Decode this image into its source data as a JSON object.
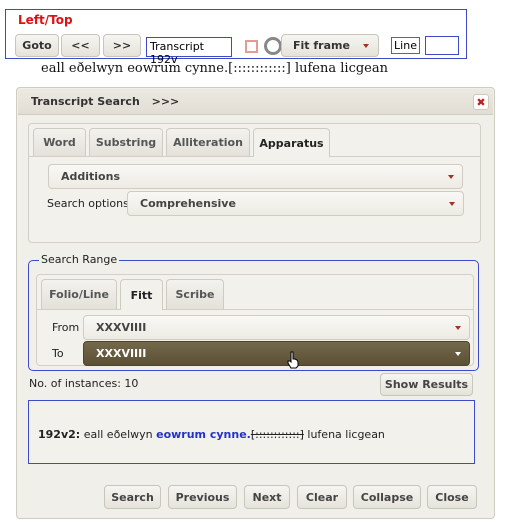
{
  "toolbar": {
    "title": "Left/Top",
    "goto_label": "Goto",
    "prev_label": "<<",
    "next_label": ">>",
    "page_value": "Transcript 192v",
    "fit_label": "Fit frame",
    "line_label": "Line",
    "line_value": ""
  },
  "transcript": {
    "text": "eall eðelwyn eowrum cynne.[::::::::::::] lufena licgean"
  },
  "dialog": {
    "title": "Transcript Search",
    "title_arrows": ">>>",
    "close_symbol": "✖",
    "tabs": [
      "Word",
      "Substring",
      "Alliteration",
      "Apparatus"
    ],
    "active_tab": "Apparatus",
    "apparatus_select": "Additions",
    "search_options_label": "Search options:",
    "search_options_value": "Comprehensive",
    "range": {
      "legend": "Search Range",
      "tabs": [
        "Folio/Line",
        "Fitt",
        "Scribe"
      ],
      "active_tab": "Fitt",
      "from_label": "From",
      "from_value": "XXXVIIII",
      "to_label": "To",
      "to_value": "XXXVIIII"
    },
    "instances_text": "No. of instances: 10",
    "show_results_label": "Show Results",
    "result": {
      "ref": "192v2:",
      "before": "eall eðelwyn",
      "hit": "eowrum cynne.",
      "bracket": "[::::::::::::]",
      "after": "lufena licgean"
    },
    "buttons": [
      "Search",
      "Previous",
      "Next",
      "Clear",
      "Collapse",
      "Close"
    ]
  },
  "colors": {
    "accent_border": "#3d4bc7",
    "title_red": "#dd1111",
    "dark_select": "#5b4f35",
    "highlight": "#2431c8"
  }
}
